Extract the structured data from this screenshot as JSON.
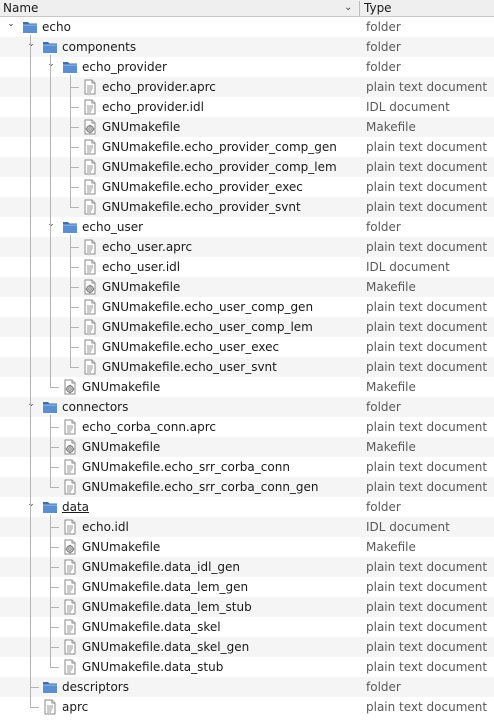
{
  "header": {
    "name_label": "Name",
    "type_label": "Type",
    "sort_icon": "chevron-down-icon"
  },
  "rows": [
    {
      "depth": 0,
      "kind": "folder",
      "expanded": true,
      "name": "echo",
      "type": "folder"
    },
    {
      "depth": 1,
      "kind": "folder",
      "expanded": true,
      "name": "components",
      "type": "folder"
    },
    {
      "depth": 2,
      "kind": "folder",
      "expanded": true,
      "name": "echo_provider",
      "type": "folder"
    },
    {
      "depth": 3,
      "kind": "text",
      "name": "echo_provider.aprc",
      "type": "plain text document"
    },
    {
      "depth": 3,
      "kind": "text",
      "name": "echo_provider.idl",
      "type": "IDL document"
    },
    {
      "depth": 3,
      "kind": "make",
      "name": "GNUmakefile",
      "type": "Makefile"
    },
    {
      "depth": 3,
      "kind": "text",
      "name": "GNUmakefile.echo_provider_comp_gen",
      "type": "plain text document"
    },
    {
      "depth": 3,
      "kind": "text",
      "name": "GNUmakefile.echo_provider_comp_lem",
      "type": "plain text document"
    },
    {
      "depth": 3,
      "kind": "text",
      "name": "GNUmakefile.echo_provider_exec",
      "type": "plain text document"
    },
    {
      "depth": 3,
      "kind": "text",
      "name": "GNUmakefile.echo_provider_svnt",
      "type": "plain text document"
    },
    {
      "depth": 2,
      "kind": "folder",
      "expanded": true,
      "name": "echo_user",
      "type": "folder"
    },
    {
      "depth": 3,
      "kind": "text",
      "name": "echo_user.aprc",
      "type": "plain text document"
    },
    {
      "depth": 3,
      "kind": "text",
      "name": "echo_user.idl",
      "type": "IDL document"
    },
    {
      "depth": 3,
      "kind": "make",
      "name": "GNUmakefile",
      "type": "Makefile"
    },
    {
      "depth": 3,
      "kind": "text",
      "name": "GNUmakefile.echo_user_comp_gen",
      "type": "plain text document"
    },
    {
      "depth": 3,
      "kind": "text",
      "name": "GNUmakefile.echo_user_comp_lem",
      "type": "plain text document"
    },
    {
      "depth": 3,
      "kind": "text",
      "name": "GNUmakefile.echo_user_exec",
      "type": "plain text document"
    },
    {
      "depth": 3,
      "kind": "text",
      "name": "GNUmakefile.echo_user_svnt",
      "type": "plain text document"
    },
    {
      "depth": 2,
      "kind": "make",
      "name": "GNUmakefile",
      "type": "Makefile"
    },
    {
      "depth": 1,
      "kind": "folder",
      "expanded": true,
      "name": "connectors",
      "type": "folder"
    },
    {
      "depth": 2,
      "kind": "text",
      "name": "echo_corba_conn.aprc",
      "type": "plain text document"
    },
    {
      "depth": 2,
      "kind": "make",
      "name": "GNUmakefile",
      "type": "Makefile"
    },
    {
      "depth": 2,
      "kind": "text",
      "name": "GNUmakefile.echo_srr_corba_conn",
      "type": "plain text document"
    },
    {
      "depth": 2,
      "kind": "text",
      "name": "GNUmakefile.echo_srr_corba_conn_gen",
      "type": "plain text document"
    },
    {
      "depth": 1,
      "kind": "folder",
      "expanded": true,
      "underline": true,
      "name": "data",
      "type": "folder"
    },
    {
      "depth": 2,
      "kind": "text",
      "name": "echo.idl",
      "type": "IDL document"
    },
    {
      "depth": 2,
      "kind": "make",
      "name": "GNUmakefile",
      "type": "Makefile"
    },
    {
      "depth": 2,
      "kind": "text",
      "name": "GNUmakefile.data_idl_gen",
      "type": "plain text document"
    },
    {
      "depth": 2,
      "kind": "text",
      "name": "GNUmakefile.data_lem_gen",
      "type": "plain text document"
    },
    {
      "depth": 2,
      "kind": "text",
      "name": "GNUmakefile.data_lem_stub",
      "type": "plain text document"
    },
    {
      "depth": 2,
      "kind": "text",
      "name": "GNUmakefile.data_skel",
      "type": "plain text document"
    },
    {
      "depth": 2,
      "kind": "text",
      "name": "GNUmakefile.data_skel_gen",
      "type": "plain text document"
    },
    {
      "depth": 2,
      "kind": "text",
      "name": "GNUmakefile.data_stub",
      "type": "plain text document"
    },
    {
      "depth": 1,
      "kind": "folder",
      "expanded": false,
      "name": "descriptors",
      "type": "folder"
    },
    {
      "depth": 1,
      "kind": "text",
      "name": "aprc",
      "type": "plain text document"
    }
  ],
  "colors": {
    "folder_fill": "#5b8fd0",
    "folder_tab": "#3f6fb0",
    "tree_line": "#b4b4b4",
    "alt_row": "#f5f5f5"
  }
}
